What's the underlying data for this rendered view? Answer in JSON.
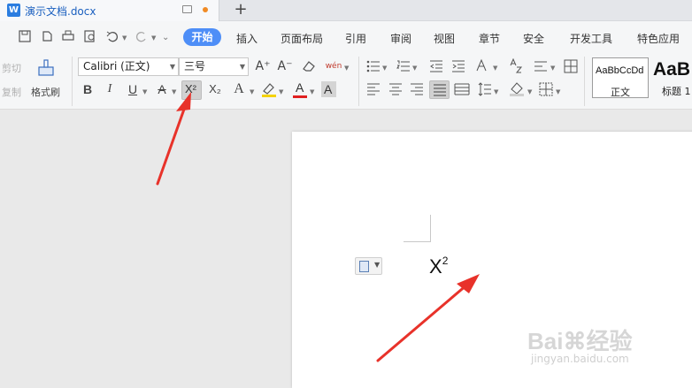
{
  "window": {
    "doc_title": "演示文档.docx",
    "logo_letter": "W",
    "new_tab": "+"
  },
  "menu": {
    "active": "开始",
    "items": [
      "插入",
      "页面布局",
      "引用",
      "审阅",
      "视图",
      "章节",
      "安全",
      "开发工具",
      "特色应用"
    ]
  },
  "ribbon": {
    "cut": "剪切",
    "copy": "复制",
    "format_painter": "格式刷",
    "font_name": "Calibri (正文)",
    "font_size": "三号",
    "bold": "B",
    "italic": "I",
    "underline": "U",
    "strike": "A",
    "superscript": "X²",
    "subscript": "X₂",
    "font_effect": "A",
    "font_color": "A",
    "char_shade": "A",
    "grow_font": "A⁺",
    "shrink_font": "A⁻",
    "phonetic": "wén"
  },
  "styles": [
    {
      "sample": "AaBbCcDd",
      "name": "正文"
    },
    {
      "sample": "AaB",
      "name": "标题 1"
    }
  ],
  "document": {
    "base": "X",
    "sup": "2"
  },
  "watermark": {
    "brand": "Bai⌘经验",
    "url": "jingyan.baidu.com"
  },
  "colors": {
    "accent": "#4e8ef7",
    "arrow": "#e8322a"
  }
}
